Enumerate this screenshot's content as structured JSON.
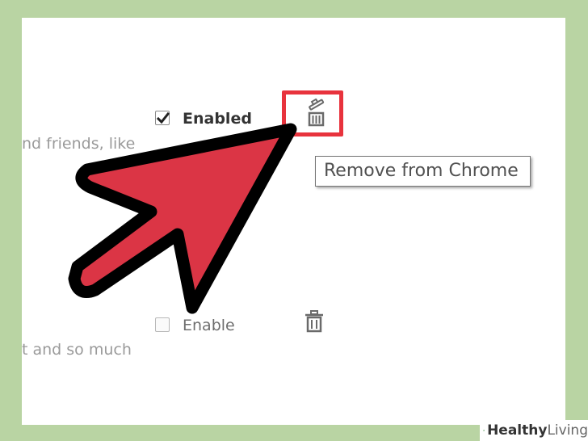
{
  "colors": {
    "background": "#b9d4a3",
    "highlight": "#e8333d",
    "arrow_fill": "#db3545",
    "arrow_outline": "#000000",
    "brand_accent": "#2e7d32"
  },
  "extensions": [
    {
      "description_fragment": "nd friends, like",
      "checkbox_checked": true,
      "checkbox_label": "Enabled",
      "trash_icon": "trash-icon"
    },
    {
      "description_fragment": "t and so much",
      "checkbox_checked": false,
      "checkbox_label": "Enable",
      "trash_icon": "trash-icon"
    }
  ],
  "tooltip": {
    "text": "Remove from Chrome"
  },
  "annotation": {
    "arrow_icon": "arrow-pointer-icon",
    "highlight": "remove-button-highlight"
  },
  "brand": {
    "text_bold": "Healthy",
    "text_regular": "Living",
    "icon": "plus-leaf-icon"
  }
}
